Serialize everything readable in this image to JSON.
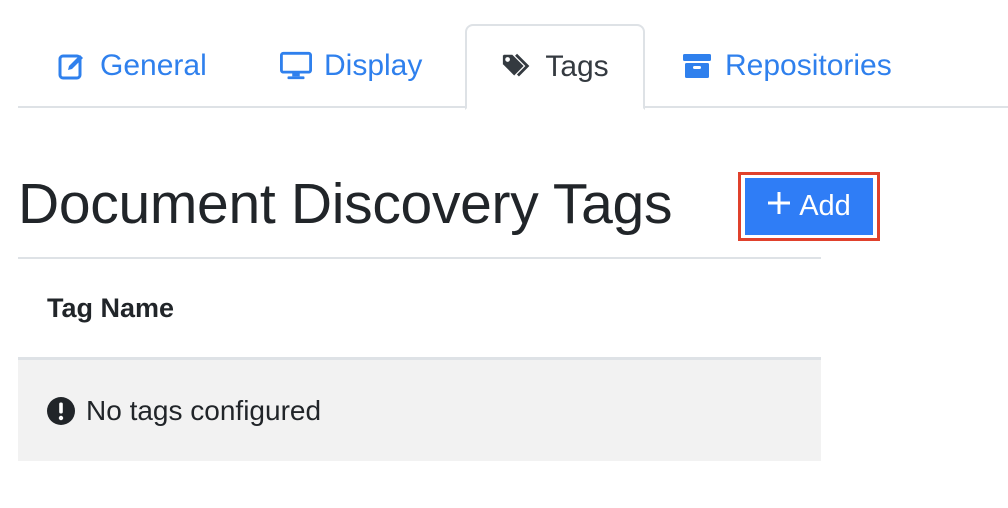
{
  "tabs": [
    {
      "label": "General",
      "icon": "edit-icon",
      "active": false
    },
    {
      "label": "Display",
      "icon": "monitor-icon",
      "active": false
    },
    {
      "label": "Tags",
      "icon": "tags-icon",
      "active": true
    },
    {
      "label": "Repositories",
      "icon": "archive-icon",
      "active": false
    }
  ],
  "page": {
    "title": "Document Discovery Tags",
    "add_button": {
      "icon": "plus-icon",
      "label": "Add"
    }
  },
  "table": {
    "columns": [
      "Tag Name"
    ],
    "empty_message": "No tags configured",
    "empty_icon": "exclamation-circle-icon"
  },
  "colors": {
    "link": "#2f80ed",
    "primary_button": "#2f7df6",
    "highlight_frame": "#e0412c",
    "empty_row_bg": "#f2f2f2",
    "border": "#dee2e6"
  }
}
